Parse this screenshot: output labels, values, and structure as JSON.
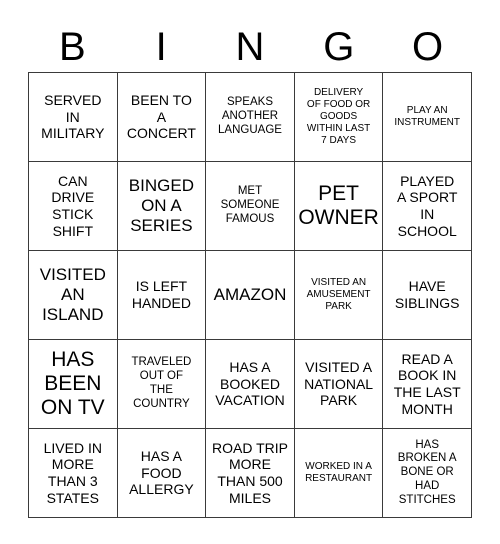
{
  "card": {
    "title": "BINGO",
    "header_letters": [
      "B",
      "I",
      "N",
      "G",
      "O"
    ],
    "columns": 5,
    "rows": 5,
    "border_color": "#3a3a3a",
    "background_color": "#ffffff",
    "text_color": "#000000",
    "cells": [
      [
        {
          "text": "SERVED\nIN\nMILITARY",
          "size": "md"
        },
        {
          "text": "BEEN TO\nA\nCONCERT",
          "size": "md"
        },
        {
          "text": "SPEAKS\nANOTHER\nLANGUAGE",
          "size": "sm"
        },
        {
          "text": "DELIVERY\nOF FOOD OR\nGOODS\nWITHIN LAST\n7 DAYS",
          "size": "xs"
        },
        {
          "text": "PLAY AN\nINSTRUMENT",
          "size": "xs"
        }
      ],
      [
        {
          "text": "CAN\nDRIVE\nSTICK\nSHIFT",
          "size": "md"
        },
        {
          "text": "BINGED\nON A\nSERIES",
          "size": "lg"
        },
        {
          "text": "MET\nSOMEONE\nFAMOUS",
          "size": "sm"
        },
        {
          "text": "PET\nOWNER",
          "size": "xl"
        },
        {
          "text": "PLAYED\nA SPORT\nIN\nSCHOOL",
          "size": "md"
        }
      ],
      [
        {
          "text": "VISITED\nAN\nISLAND",
          "size": "lg"
        },
        {
          "text": "IS LEFT\nHANDED",
          "size": "md"
        },
        {
          "text": "AMAZON",
          "size": "lg"
        },
        {
          "text": "VISITED AN\nAMUSEMENT\nPARK",
          "size": "xs"
        },
        {
          "text": "HAVE\nSIBLINGS",
          "size": "md"
        }
      ],
      [
        {
          "text": "HAS\nBEEN\nON TV",
          "size": "xl"
        },
        {
          "text": "TRAVELED\nOUT OF\nTHE\nCOUNTRY",
          "size": "sm"
        },
        {
          "text": "HAS A\nBOOKED\nVACATION",
          "size": "md"
        },
        {
          "text": "VISITED A\nNATIONAL\nPARK",
          "size": "md"
        },
        {
          "text": "READ A\nBOOK IN\nTHE LAST\nMONTH",
          "size": "md"
        }
      ],
      [
        {
          "text": "LIVED IN\nMORE\nTHAN 3\nSTATES",
          "size": "md"
        },
        {
          "text": "HAS A\nFOOD\nALLERGY",
          "size": "md"
        },
        {
          "text": "ROAD TRIP\nMORE\nTHAN 500\nMILES",
          "size": "md"
        },
        {
          "text": "WORKED IN A\nRESTAURANT",
          "size": "xs"
        },
        {
          "text": "HAS\nBROKEN A\nBONE OR\nHAD\nSTITCHES",
          "size": "sm"
        }
      ]
    ]
  }
}
